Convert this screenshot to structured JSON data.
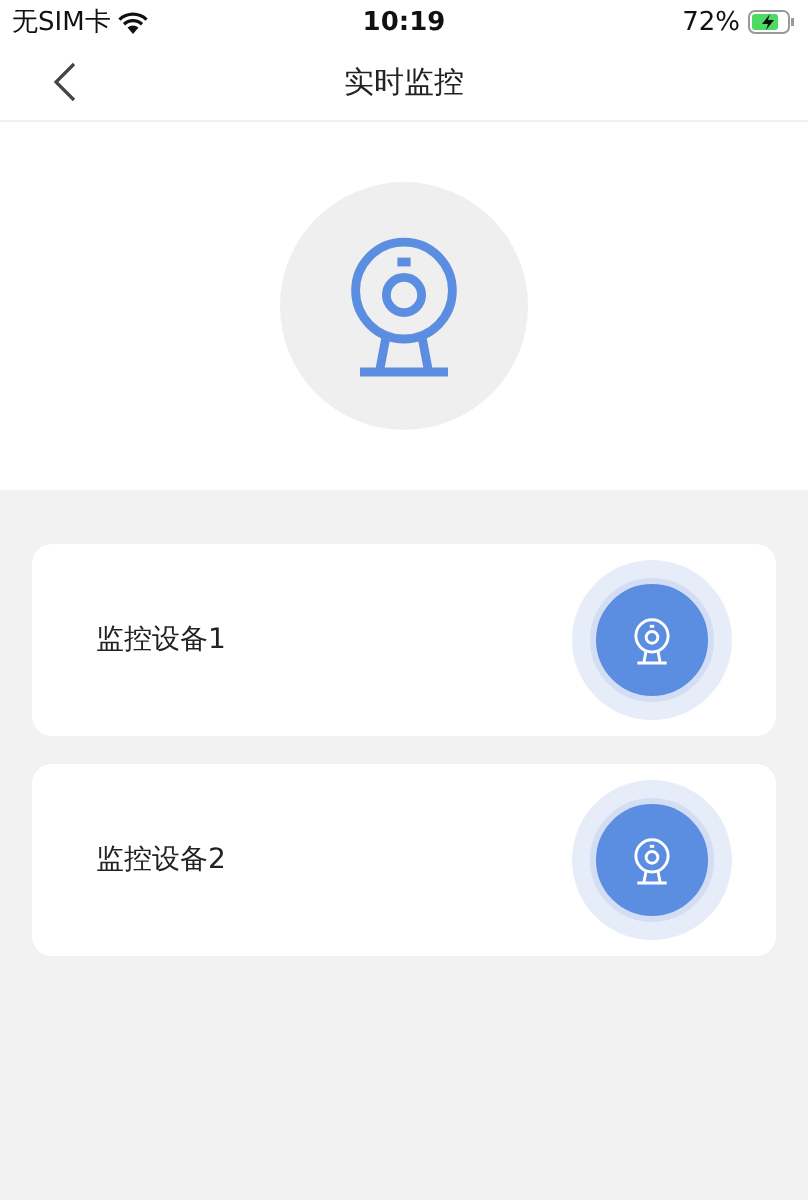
{
  "status_bar": {
    "carrier": "无SIM卡",
    "time": "10:19",
    "battery": "72%",
    "charging": true
  },
  "nav": {
    "title": "实时监控"
  },
  "devices": [
    {
      "name": "监控设备1"
    },
    {
      "name": "监控设备2"
    }
  ]
}
